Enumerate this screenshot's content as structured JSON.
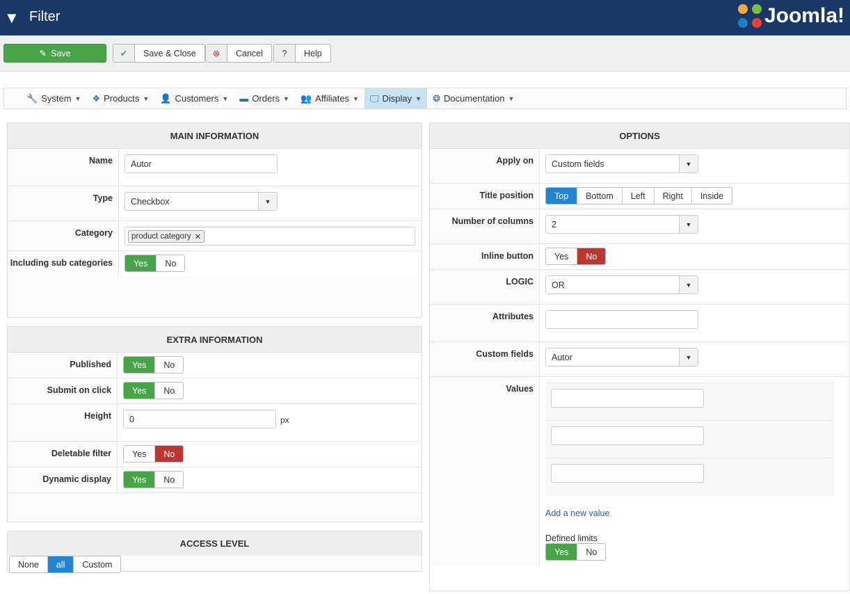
{
  "header": {
    "title": "Filter",
    "logo_text": "Joomla!"
  },
  "toolbar": {
    "save": "Save",
    "save_close": "Save & Close",
    "cancel": "Cancel",
    "help": "Help"
  },
  "menu": [
    {
      "label": "System",
      "icon": "wrench-icon"
    },
    {
      "label": "Products",
      "icon": "cubes-icon"
    },
    {
      "label": "Customers",
      "icon": "user-icon"
    },
    {
      "label": "Orders",
      "icon": "credit-card-icon"
    },
    {
      "label": "Affiliates",
      "icon": "users-icon"
    },
    {
      "label": "Display",
      "icon": "desktop-icon",
      "active": true
    },
    {
      "label": "Documentation",
      "icon": "life-ring-icon"
    }
  ],
  "main": {
    "title": "MAIN INFORMATION",
    "name_label": "Name",
    "name_value": "Autor",
    "type_label": "Type",
    "type_value": "Checkbox",
    "category_label": "Category",
    "category_tag": "product category",
    "sub_label": "Including sub categories",
    "yes": "Yes",
    "no": "No"
  },
  "extra": {
    "title": "EXTRA INFORMATION",
    "published": "Published",
    "submit": "Submit on click",
    "height": "Height",
    "height_value": "0",
    "height_unit": "px",
    "deletable": "Deletable filter",
    "dynamic": "Dynamic display"
  },
  "access": {
    "title": "ACCESS LEVEL",
    "options": [
      "None",
      "all",
      "Custom"
    ]
  },
  "options": {
    "title": "OPTIONS",
    "apply_label": "Apply on",
    "apply_value": "Custom fields",
    "title_pos_label": "Title position",
    "title_pos": [
      "Top",
      "Bottom",
      "Left",
      "Right",
      "Inside"
    ],
    "columns_label": "Number of columns",
    "columns_value": "2",
    "inline_label": "Inline button",
    "logic_label": "LOGIC",
    "logic_value": "OR",
    "attributes_label": "Attributes",
    "custom_label": "Custom fields",
    "custom_value": "Autor",
    "values_label": "Values",
    "add_value": "Add a new value",
    "limits_label": "Defined limits"
  },
  "colors": {
    "header": "#1a3867",
    "green": "#46a546",
    "red": "#bd362f",
    "blue": "#2384d3"
  }
}
